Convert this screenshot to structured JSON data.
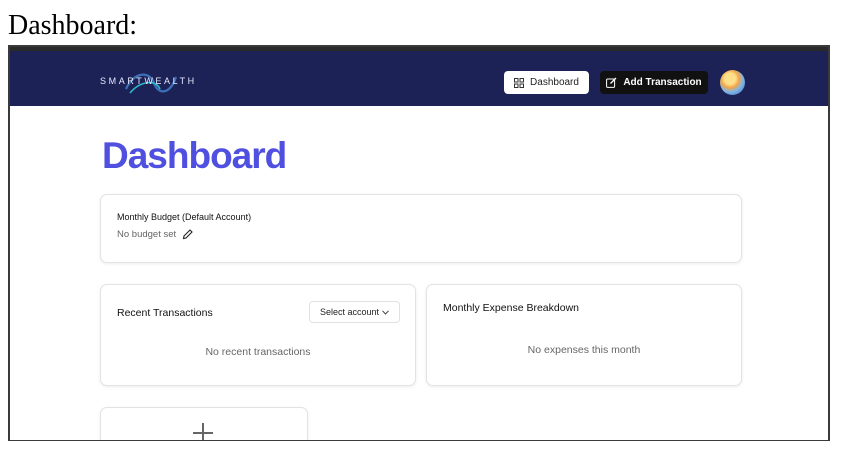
{
  "caption": "Dashboard:",
  "navbar": {
    "logo_text": "SMARTWEALTH",
    "dashboard_label": "Dashboard",
    "add_transaction_label": "Add Transaction",
    "bg_color": "#1c2255"
  },
  "main": {
    "title": "Dashboard",
    "title_color": "#4f4fe0",
    "budget": {
      "title": "Monthly Budget (Default Account)",
      "status": "No budget set"
    },
    "recent_transactions": {
      "title": "Recent Transactions",
      "select_label": "Select account",
      "empty_text": "No recent transactions"
    },
    "expense_breakdown": {
      "title": "Monthly Expense Breakdown",
      "empty_text": "No expenses this month"
    }
  },
  "icons": {
    "dashboard": "grid-icon",
    "add": "edit-square-icon",
    "budget_edit": "pencil-icon",
    "select": "chevron-down-icon",
    "add_card": "plus-icon"
  }
}
